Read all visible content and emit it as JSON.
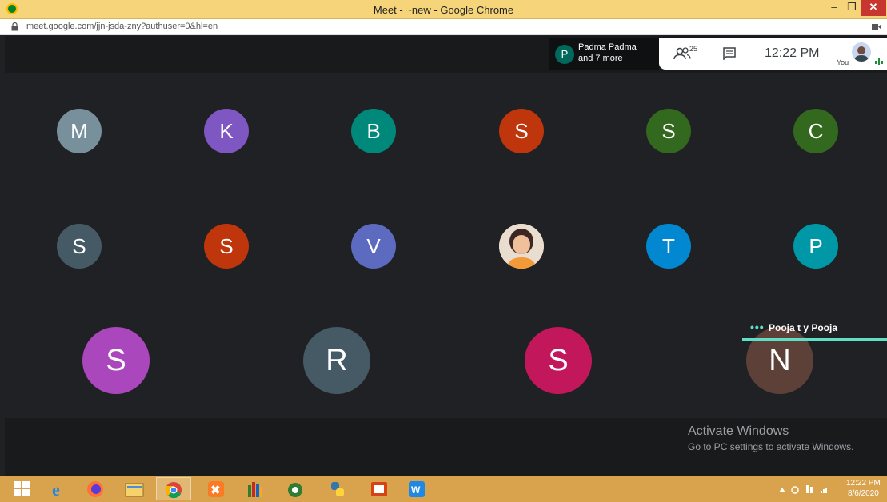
{
  "window": {
    "title": "Meet - ~new - Google Chrome",
    "minimize": "–",
    "maximize": "❐",
    "close": "✕"
  },
  "browser": {
    "url": "meet.google.com/jjn-jsda-zny?authuser=0&hl=en"
  },
  "meet": {
    "presenter": {
      "initial": "P",
      "line1": "Padma Padma",
      "line2": "and 7 more"
    },
    "participant_count": "25",
    "time": "12:22  PM",
    "self_label": "You",
    "active_speaker": "Pooja t y Pooja",
    "participants_row1": [
      {
        "initial": "M",
        "color": "#78909c"
      },
      {
        "initial": "K",
        "color": "#7e57c2"
      },
      {
        "initial": "B",
        "color": "#00897b"
      },
      {
        "initial": "S",
        "color": "#bf360c"
      },
      {
        "initial": "S",
        "color": "#33691e"
      },
      {
        "initial": "C",
        "color": "#33691e"
      }
    ],
    "participants_row2": [
      {
        "initial": "S",
        "color": "#455a64"
      },
      {
        "initial": "S",
        "color": "#bf360c"
      },
      {
        "initial": "V",
        "color": "#5c6bc0"
      },
      {
        "initial": "",
        "color": "#f3b27a",
        "photo": true
      },
      {
        "initial": "T",
        "color": "#0288d1"
      },
      {
        "initial": "P",
        "color": "#0097a7"
      }
    ],
    "participants_row3": [
      {
        "initial": "S",
        "color": "#ab47bc"
      },
      {
        "initial": "R",
        "color": "#455a64"
      },
      {
        "initial": "S",
        "color": "#c2185b"
      },
      {
        "initial": "N",
        "color": "#5d4037"
      }
    ]
  },
  "watermark": {
    "line1": "Activate Windows",
    "line2": "Go to PC settings to activate Windows."
  },
  "taskbar": {
    "time": "12:22 PM",
    "date": "8/6/2020"
  }
}
